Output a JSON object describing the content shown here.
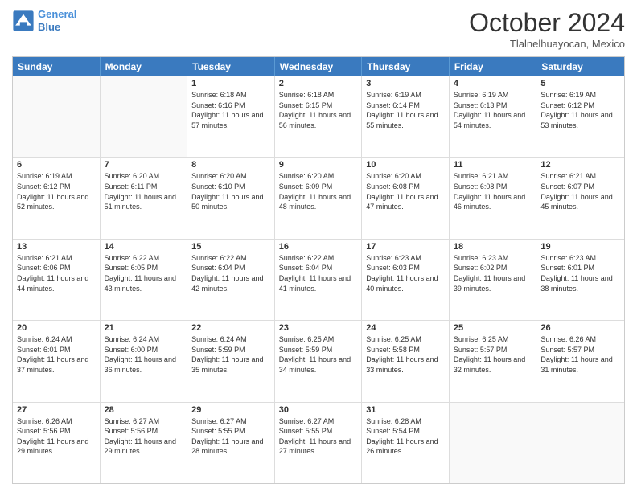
{
  "logo": {
    "line1": "General",
    "line2": "Blue"
  },
  "title": "October 2024",
  "location": "Tlalnelhuayocan, Mexico",
  "days_of_week": [
    "Sunday",
    "Monday",
    "Tuesday",
    "Wednesday",
    "Thursday",
    "Friday",
    "Saturday"
  ],
  "weeks": [
    [
      {
        "day": "",
        "info": "",
        "empty": true
      },
      {
        "day": "",
        "info": "",
        "empty": true
      },
      {
        "day": "1",
        "info": "Sunrise: 6:18 AM\nSunset: 6:16 PM\nDaylight: 11 hours and 57 minutes."
      },
      {
        "day": "2",
        "info": "Sunrise: 6:18 AM\nSunset: 6:15 PM\nDaylight: 11 hours and 56 minutes."
      },
      {
        "day": "3",
        "info": "Sunrise: 6:19 AM\nSunset: 6:14 PM\nDaylight: 11 hours and 55 minutes."
      },
      {
        "day": "4",
        "info": "Sunrise: 6:19 AM\nSunset: 6:13 PM\nDaylight: 11 hours and 54 minutes."
      },
      {
        "day": "5",
        "info": "Sunrise: 6:19 AM\nSunset: 6:12 PM\nDaylight: 11 hours and 53 minutes."
      }
    ],
    [
      {
        "day": "6",
        "info": "Sunrise: 6:19 AM\nSunset: 6:12 PM\nDaylight: 11 hours and 52 minutes."
      },
      {
        "day": "7",
        "info": "Sunrise: 6:20 AM\nSunset: 6:11 PM\nDaylight: 11 hours and 51 minutes."
      },
      {
        "day": "8",
        "info": "Sunrise: 6:20 AM\nSunset: 6:10 PM\nDaylight: 11 hours and 50 minutes."
      },
      {
        "day": "9",
        "info": "Sunrise: 6:20 AM\nSunset: 6:09 PM\nDaylight: 11 hours and 48 minutes."
      },
      {
        "day": "10",
        "info": "Sunrise: 6:20 AM\nSunset: 6:08 PM\nDaylight: 11 hours and 47 minutes."
      },
      {
        "day": "11",
        "info": "Sunrise: 6:21 AM\nSunset: 6:08 PM\nDaylight: 11 hours and 46 minutes."
      },
      {
        "day": "12",
        "info": "Sunrise: 6:21 AM\nSunset: 6:07 PM\nDaylight: 11 hours and 45 minutes."
      }
    ],
    [
      {
        "day": "13",
        "info": "Sunrise: 6:21 AM\nSunset: 6:06 PM\nDaylight: 11 hours and 44 minutes."
      },
      {
        "day": "14",
        "info": "Sunrise: 6:22 AM\nSunset: 6:05 PM\nDaylight: 11 hours and 43 minutes."
      },
      {
        "day": "15",
        "info": "Sunrise: 6:22 AM\nSunset: 6:04 PM\nDaylight: 11 hours and 42 minutes."
      },
      {
        "day": "16",
        "info": "Sunrise: 6:22 AM\nSunset: 6:04 PM\nDaylight: 11 hours and 41 minutes."
      },
      {
        "day": "17",
        "info": "Sunrise: 6:23 AM\nSunset: 6:03 PM\nDaylight: 11 hours and 40 minutes."
      },
      {
        "day": "18",
        "info": "Sunrise: 6:23 AM\nSunset: 6:02 PM\nDaylight: 11 hours and 39 minutes."
      },
      {
        "day": "19",
        "info": "Sunrise: 6:23 AM\nSunset: 6:01 PM\nDaylight: 11 hours and 38 minutes."
      }
    ],
    [
      {
        "day": "20",
        "info": "Sunrise: 6:24 AM\nSunset: 6:01 PM\nDaylight: 11 hours and 37 minutes."
      },
      {
        "day": "21",
        "info": "Sunrise: 6:24 AM\nSunset: 6:00 PM\nDaylight: 11 hours and 36 minutes."
      },
      {
        "day": "22",
        "info": "Sunrise: 6:24 AM\nSunset: 5:59 PM\nDaylight: 11 hours and 35 minutes."
      },
      {
        "day": "23",
        "info": "Sunrise: 6:25 AM\nSunset: 5:59 PM\nDaylight: 11 hours and 34 minutes."
      },
      {
        "day": "24",
        "info": "Sunrise: 6:25 AM\nSunset: 5:58 PM\nDaylight: 11 hours and 33 minutes."
      },
      {
        "day": "25",
        "info": "Sunrise: 6:25 AM\nSunset: 5:57 PM\nDaylight: 11 hours and 32 minutes."
      },
      {
        "day": "26",
        "info": "Sunrise: 6:26 AM\nSunset: 5:57 PM\nDaylight: 11 hours and 31 minutes."
      }
    ],
    [
      {
        "day": "27",
        "info": "Sunrise: 6:26 AM\nSunset: 5:56 PM\nDaylight: 11 hours and 29 minutes."
      },
      {
        "day": "28",
        "info": "Sunrise: 6:27 AM\nSunset: 5:56 PM\nDaylight: 11 hours and 29 minutes."
      },
      {
        "day": "29",
        "info": "Sunrise: 6:27 AM\nSunset: 5:55 PM\nDaylight: 11 hours and 28 minutes."
      },
      {
        "day": "30",
        "info": "Sunrise: 6:27 AM\nSunset: 5:55 PM\nDaylight: 11 hours and 27 minutes."
      },
      {
        "day": "31",
        "info": "Sunrise: 6:28 AM\nSunset: 5:54 PM\nDaylight: 11 hours and 26 minutes."
      },
      {
        "day": "",
        "info": "",
        "empty": true
      },
      {
        "day": "",
        "info": "",
        "empty": true
      }
    ]
  ]
}
